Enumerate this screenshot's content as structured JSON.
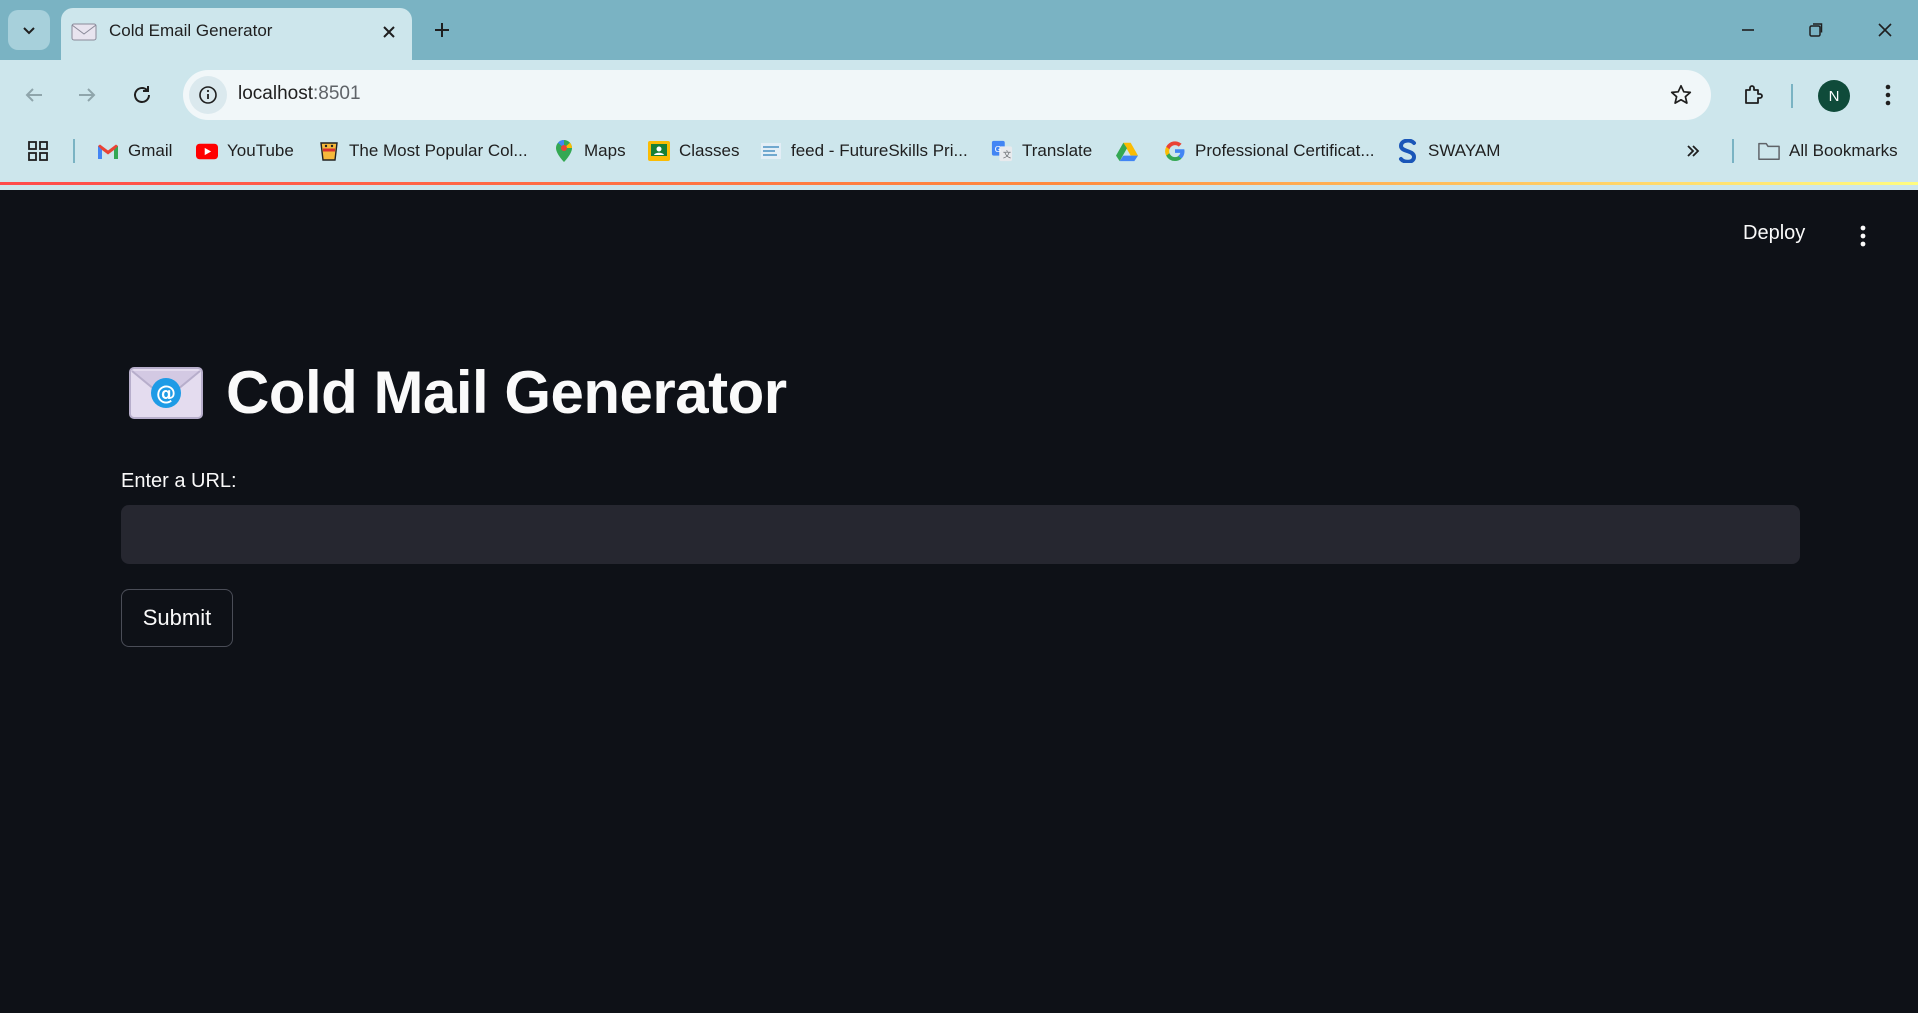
{
  "browser": {
    "tab": {
      "title": "Cold Email Generator"
    },
    "address": {
      "host": "localhost",
      "port": ":8501"
    },
    "profile_initial": "N",
    "bookmarks": [
      {
        "label": "Gmail",
        "icon": "gmail-icon"
      },
      {
        "label": "YouTube",
        "icon": "youtube-icon"
      },
      {
        "label": "The Most Popular Col...",
        "icon": "cup-icon"
      },
      {
        "label": "Maps",
        "icon": "maps-icon"
      },
      {
        "label": "Classes",
        "icon": "classroom-icon"
      },
      {
        "label": "feed - FutureSkills Pri...",
        "icon": "futureskills-icon"
      },
      {
        "label": "Translate",
        "icon": "translate-icon"
      },
      {
        "label": "",
        "icon": "google-drive-icon"
      },
      {
        "label": "Professional Certificat...",
        "icon": "google-icon"
      },
      {
        "label": "SWAYAM",
        "icon": "swayam-icon"
      }
    ],
    "all_bookmarks_label": "All Bookmarks",
    "colors": {
      "tabstrip": "#7ab3c3",
      "toolbar": "#cde6ec",
      "omnibox": "#f1f7f9"
    }
  },
  "app": {
    "deploy_label": "Deploy",
    "title": "Cold Mail Generator",
    "title_icon": "envelope-with-at-icon",
    "input": {
      "label": "Enter a URL:",
      "value": "",
      "placeholder": ""
    },
    "submit_label": "Submit",
    "colors": {
      "background": "#0e1117",
      "input_bg": "#262730",
      "text": "#fafafa"
    }
  }
}
